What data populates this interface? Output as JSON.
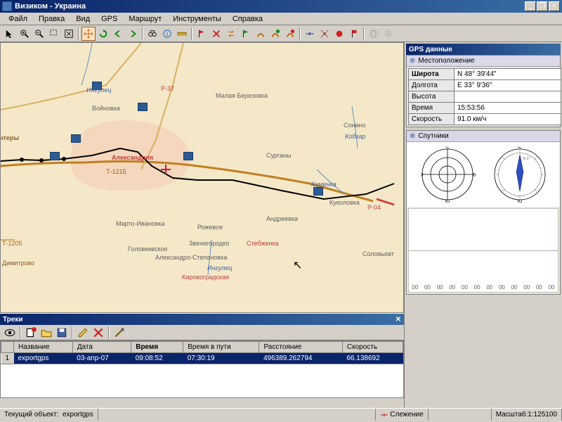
{
  "window": {
    "title": "Визиком - Украина"
  },
  "menu": {
    "items": [
      "Файл",
      "Правка",
      "Вид",
      "GPS",
      "Маршрут",
      "Инструменты",
      "Справка"
    ]
  },
  "gps_panel": {
    "title": "GPS данные",
    "location_header": "Местоположение",
    "fields": {
      "lat_label": "Широта",
      "lat_value": "N 48° 39'44\"",
      "lon_label": "Долгота",
      "lon_value": "E 33° 9'36\"",
      "alt_label": "Высота",
      "alt_value": "",
      "time_label": "Время",
      "time_value": "15:53:56",
      "speed_label": "Скорость",
      "speed_value": "91.0 км/ч"
    },
    "satellites_header": "Спутники",
    "compass": {
      "n": "С",
      "s": "Ю",
      "e": "В",
      "w": "З",
      "heading": "0.1°"
    },
    "sat_axis": [
      "00",
      "00",
      "00",
      "00",
      "00",
      "00",
      "00",
      "00",
      "00",
      "00",
      "00",
      "00"
    ]
  },
  "tracks": {
    "title": "Треки",
    "columns": [
      "",
      "Название",
      "Дата",
      "Время",
      "Время в пути",
      "Расстояние",
      "Скорость"
    ],
    "row": {
      "idx": "1",
      "name": "exportgps",
      "date": "03-апр-07",
      "time": "09:08:52",
      "duration": "07:30:19",
      "distance": "496389.262794",
      "speed": "66.138692"
    }
  },
  "map_labels": {
    "aleksandriya": "Александрия",
    "voinovka": "Войновка",
    "beriozovka": "Малая Березовка",
    "surgany": "Сурганы",
    "sonino": "Сонино",
    "t1215": "Т-1215",
    "marto": "Марто-Ивановка",
    "andreevka": "Андреевка",
    "rozhevoe": "Рожевое",
    "zvenigorod": "Звенигородко",
    "golovk": "Головкивское",
    "alekstepan": "Александро-Степановка",
    "stebzhenka": "Стебженка",
    "solov": "Соловьевт",
    "kirov": "Кировоградская",
    "dimitrovo": "Димитрово",
    "ingulets1": "Ингулец",
    "ingulets2": "Ингулец",
    "kamenka": "Каменка",
    "kukolovka": "Куколовка",
    "r37": "Р-37",
    "r04": "Р-04",
    "t1205": "Т-1205",
    "intery": "нтеры",
    "kobzar": "Кобзар"
  },
  "status": {
    "current_label": "Текущий объект:",
    "current_value": "exportgps",
    "tracking": "Слежение",
    "scale_label": "Масштаб:",
    "scale_value": "1:125100"
  }
}
